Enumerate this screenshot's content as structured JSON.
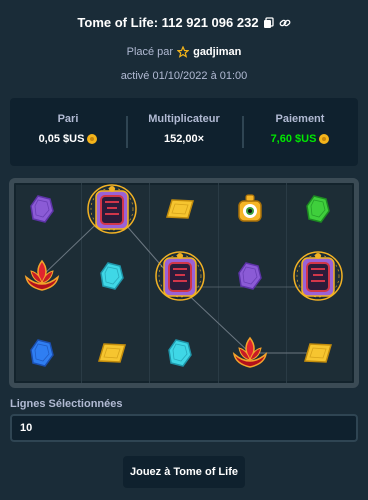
{
  "header": {
    "title": "Tome of Life: 112 921 096 232",
    "placed_prefix": "Placé par",
    "username": "gadjiman",
    "activated": "activé 01/10/2022 à 01:00"
  },
  "stats": [
    {
      "label": "Pari",
      "value": "0,05 $US",
      "color": "#ffffff"
    },
    {
      "label": "Multiplicateur",
      "value": "152,00×",
      "color": "#ffffff"
    },
    {
      "label": "Paiement",
      "value": "7,60 $US",
      "color": "#00e701"
    }
  ],
  "board": {
    "rows": [
      [
        "purple-gem-icon",
        "tome-of-life-icon",
        "yellow-gem-icon",
        "eye-lantern-icon",
        "green-gem-icon"
      ],
      [
        "red-lotus-icon",
        "cyan-gem-icon",
        "tome-of-life-icon",
        "purple-gem-icon",
        "tome-of-life-icon"
      ],
      [
        "blue-gem-icon",
        "yellow-gem-icon",
        "cyan-gem-icon",
        "red-lotus-icon",
        "yellow-gem-icon"
      ]
    ]
  },
  "lines": {
    "label": "Lignes Sélectionnées",
    "value": "10"
  },
  "play": {
    "label": "Jouez à Tome of Life"
  },
  "colors": {
    "background": "#1a2c38",
    "panel": "#0f212e",
    "payout": "#00e701"
  }
}
